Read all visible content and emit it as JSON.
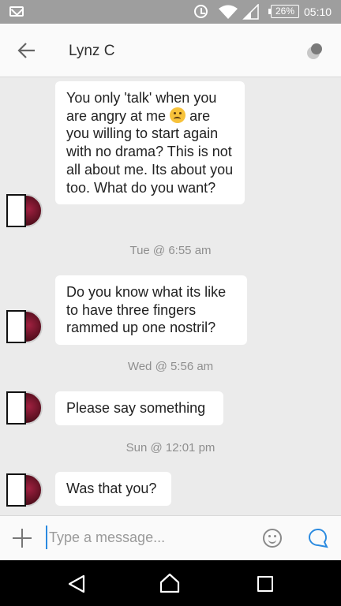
{
  "status_bar": {
    "battery": "26%",
    "time": "05:10",
    "icons": [
      "mail-icon",
      "alarm-icon",
      "wifi-icon",
      "signal-icon",
      "battery-icon"
    ]
  },
  "header": {
    "title": "Lynz C",
    "back_icon": "arrow-left-icon",
    "status_icon": "presence-dot-icon"
  },
  "messages": [
    {
      "text_before_emoji": "You only 'talk' when you are angry at me ",
      "emoji": "worried-face-emoji",
      "text_after_emoji": " are you willing to start again with no drama? This is not all about me. Its about you too. What do you want?"
    },
    {
      "text": "Do you know what its like to have three fingers rammed up one nostril?"
    },
    {
      "text": "Please say something"
    },
    {
      "text": "Was that you?"
    }
  ],
  "dates": [
    {
      "day": "Tue @",
      "time": "6:55 am"
    },
    {
      "day": "Wed @",
      "time": "5:56 am"
    },
    {
      "day": "Sun @",
      "time": "12:01 pm"
    }
  ],
  "composer": {
    "placeholder": "Type a message...",
    "value": ""
  },
  "colors": {
    "accent": "#2a8ae0",
    "status_bar": "#9e9e9e",
    "chat_background": "#ebebeb",
    "bubble": "#ffffff"
  }
}
